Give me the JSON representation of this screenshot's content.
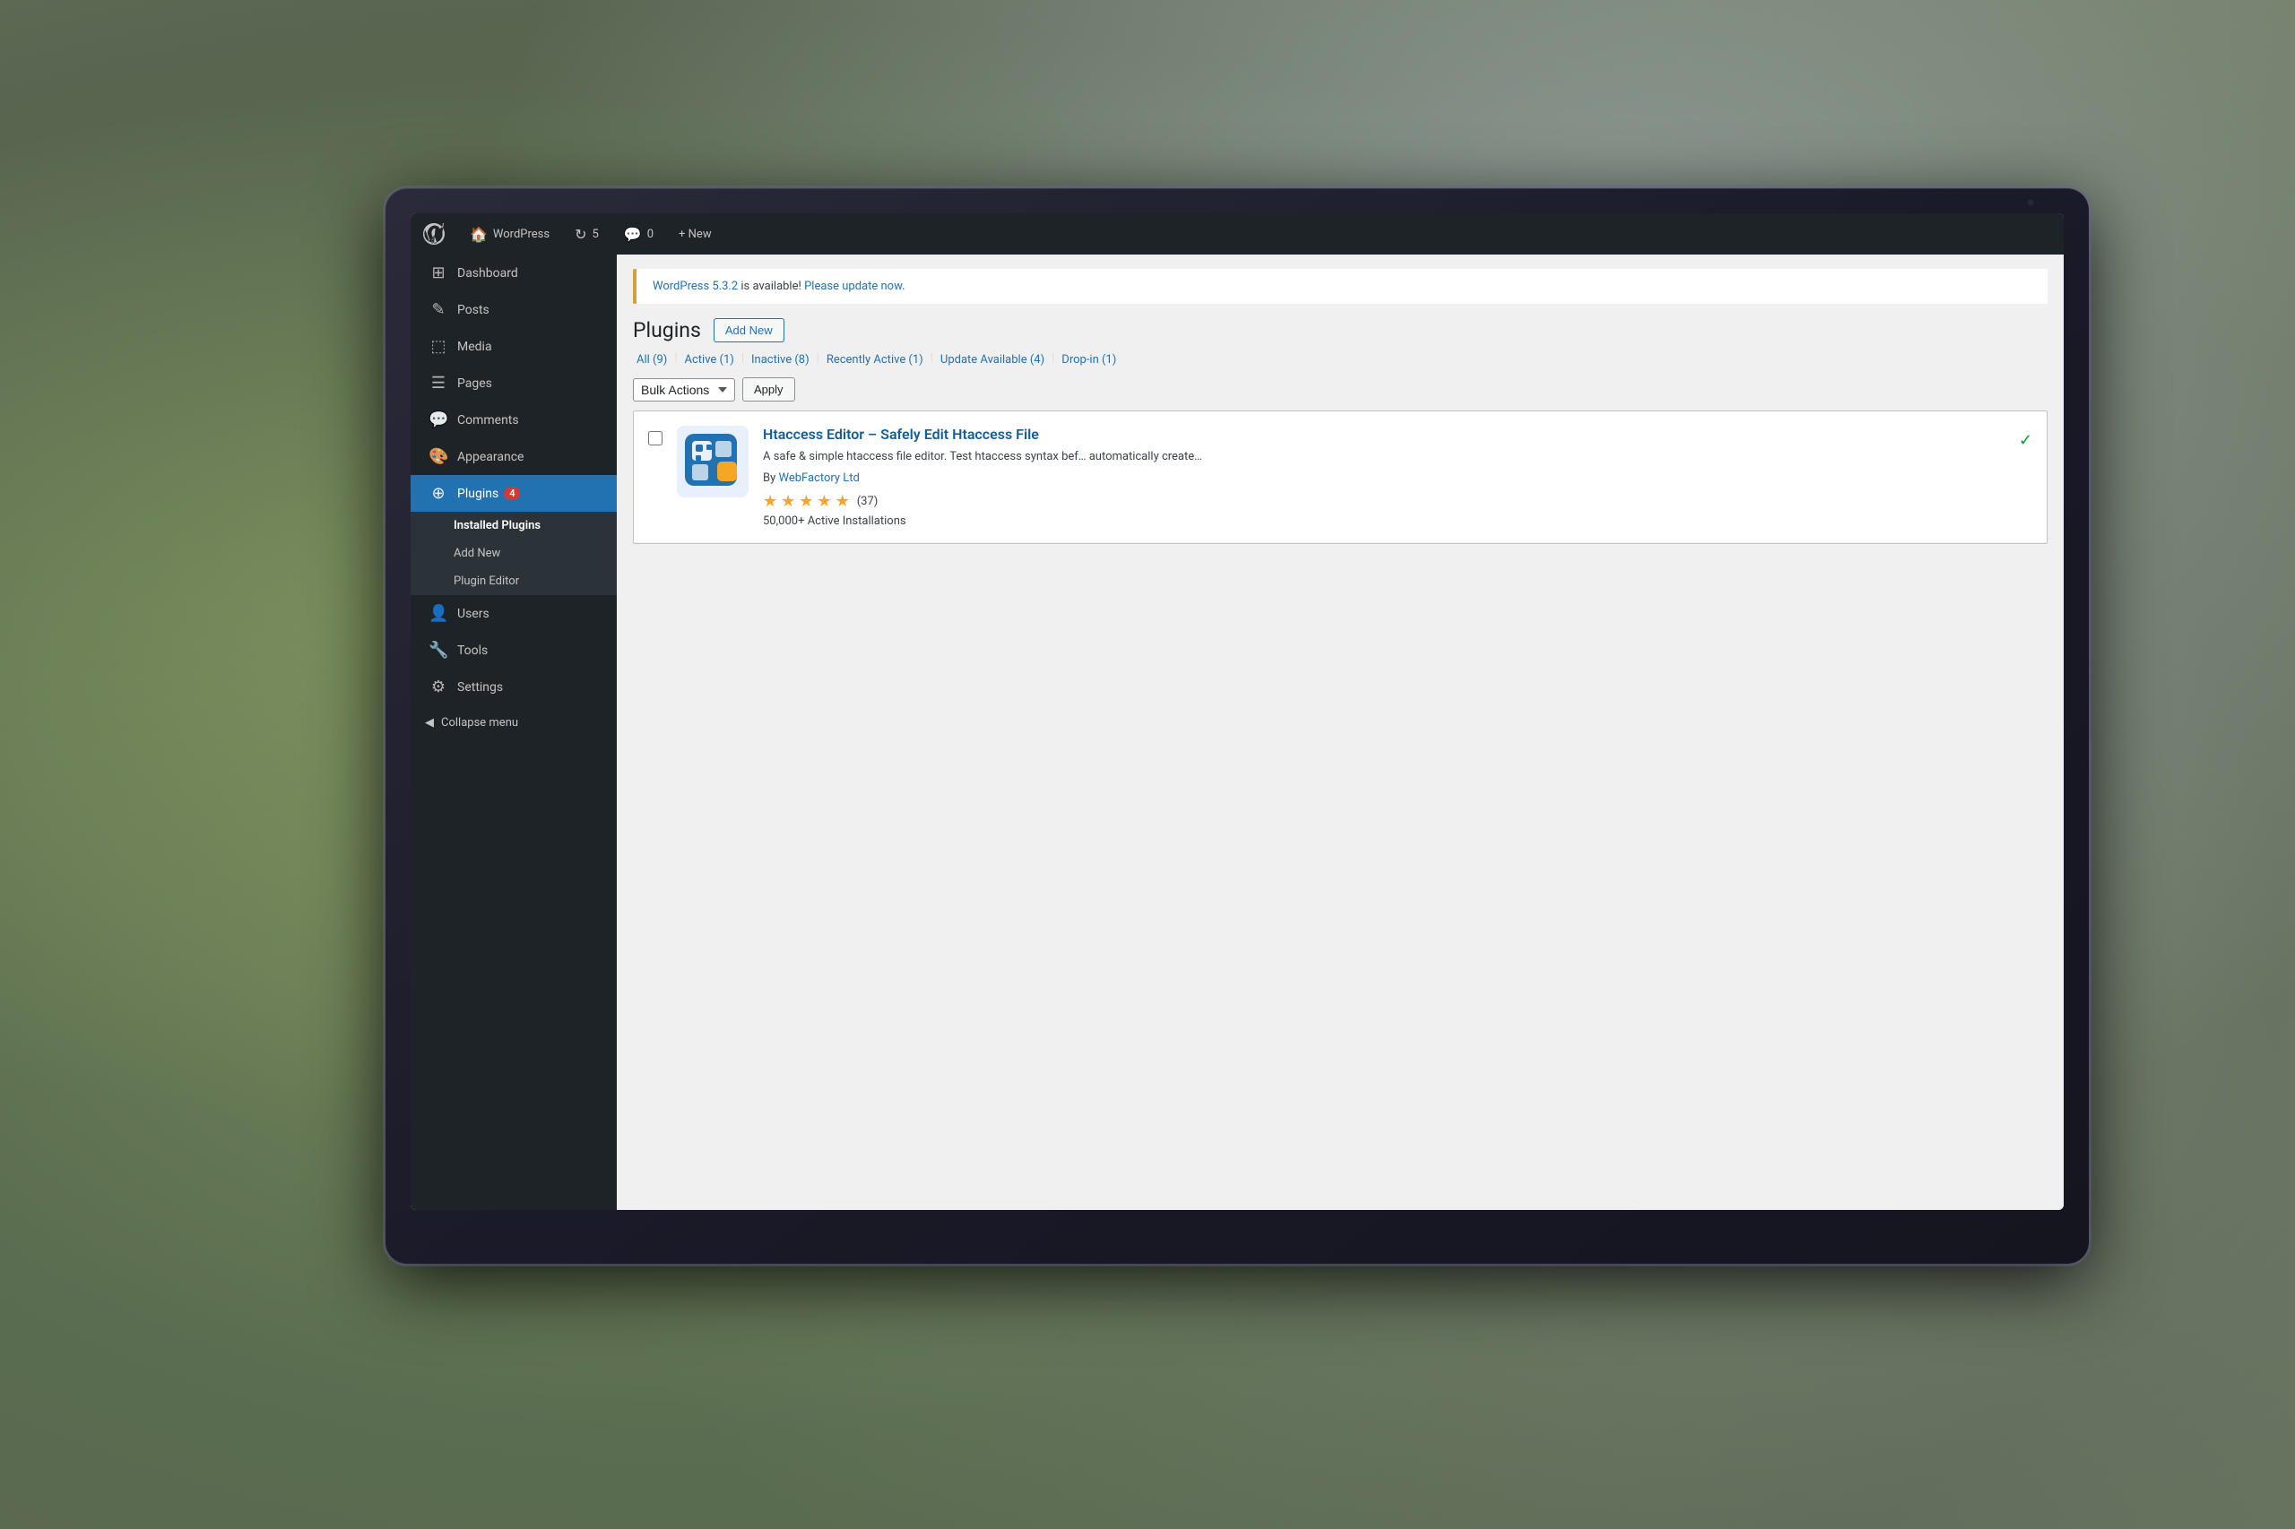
{
  "background": {
    "color1": "#7a8a6a",
    "color2": "#5a6a50"
  },
  "adminBar": {
    "wpLogoAlt": "WordPress",
    "homeLabel": "WordPress",
    "updates": "5",
    "comments": "0",
    "newLabel": "+ New"
  },
  "sidebar": {
    "items": [
      {
        "id": "dashboard",
        "label": "Dashboard",
        "icon": "⊞"
      },
      {
        "id": "posts",
        "label": "Posts",
        "icon": "✎"
      },
      {
        "id": "media",
        "label": "Media",
        "icon": "⬚"
      },
      {
        "id": "pages",
        "label": "Pages",
        "icon": "☰"
      },
      {
        "id": "comments",
        "label": "Comments",
        "icon": "💬"
      },
      {
        "id": "appearance",
        "label": "Appearance",
        "icon": "🎨"
      },
      {
        "id": "plugins",
        "label": "Plugins",
        "icon": "⊕",
        "badge": "4"
      },
      {
        "id": "users",
        "label": "Users",
        "icon": "👤"
      },
      {
        "id": "tools",
        "label": "Tools",
        "icon": "🔧"
      },
      {
        "id": "settings",
        "label": "Settings",
        "icon": "⚙"
      }
    ],
    "pluginsSubmenu": [
      {
        "id": "installed-plugins",
        "label": "Installed Plugins",
        "active": true
      },
      {
        "id": "add-new",
        "label": "Add New"
      },
      {
        "id": "plugin-editor",
        "label": "Plugin Editor"
      }
    ],
    "collapseLabel": "Collapse menu"
  },
  "updateNotice": {
    "versionLink": "WordPress 5.3.2",
    "text": " is available! ",
    "updateLink": "Please update now",
    "updateDot": "."
  },
  "pluginsPage": {
    "title": "Plugins",
    "addNewLabel": "Add New",
    "filterTabs": [
      {
        "label": "All",
        "count": "9"
      },
      {
        "label": "Active",
        "count": "1"
      },
      {
        "label": "Inactive",
        "count": "8"
      },
      {
        "label": "Recently Active",
        "count": "1"
      },
      {
        "label": "Update Available",
        "count": "4"
      },
      {
        "label": "Drop-in",
        "count": "1"
      }
    ],
    "bulkActionsLabel": "Bulk Actions",
    "applyLabel": "Apply",
    "plugin": {
      "name": "Htaccess Editor – Safely Edit Htaccess File",
      "description": "A safe & simple htaccess file editor. Test htaccess syntax bef… automatically create…",
      "author": "WebFactory Ltd",
      "stars": 5,
      "reviewCount": "37",
      "installCount": "50,000+ Active Installations"
    }
  }
}
